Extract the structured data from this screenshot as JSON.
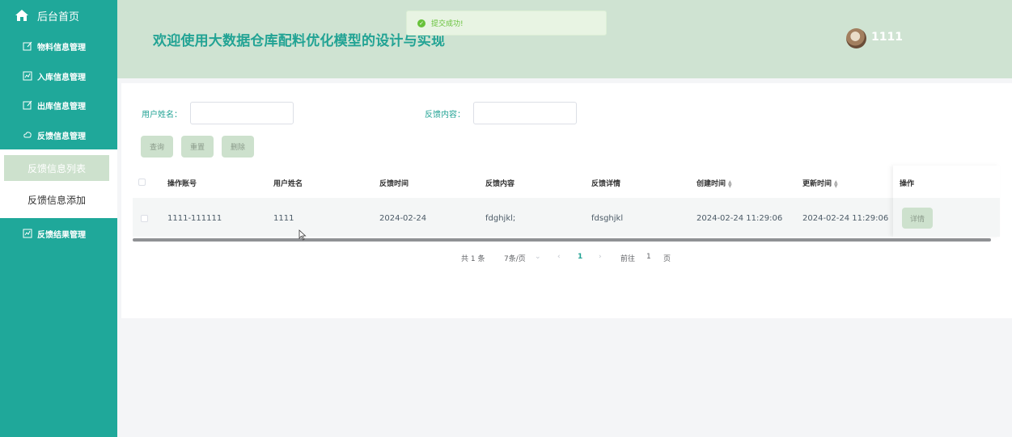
{
  "colors": {
    "sidebar": "#1fa89a",
    "header": "#cfe3d2",
    "accent": "#22a394",
    "button": "#cde1cd",
    "success": "#67c23a"
  },
  "sidebar": {
    "home_label": "后台首页",
    "items": [
      {
        "label": "物料信息管理",
        "icon": "edit-icon"
      },
      {
        "label": "入库信息管理",
        "icon": "chart-icon"
      },
      {
        "label": "出库信息管理",
        "icon": "edit-icon"
      },
      {
        "label": "反馈信息管理",
        "icon": "cloud-icon"
      },
      {
        "label": "反馈结果管理",
        "icon": "chart-icon"
      }
    ],
    "submenu": [
      {
        "label": "反馈信息列表",
        "active": true
      },
      {
        "label": "反馈信息添加",
        "active": false
      }
    ]
  },
  "header": {
    "title": "欢迎使用大数据仓库配料优化模型的设计与实现",
    "username": "1111"
  },
  "toast": {
    "message": "提交成功!"
  },
  "search": {
    "username_label": "用户姓名：",
    "username_value": "",
    "content_label": "反馈内容：",
    "content_value": ""
  },
  "buttons": {
    "query": "查询",
    "reset": "重置",
    "delete": "删除"
  },
  "table": {
    "headers": [
      "操作账号",
      "用户姓名",
      "反馈时间",
      "反馈内容",
      "反馈详情",
      "创建时间",
      "更新时间",
      "操作"
    ],
    "rows": [
      {
        "account": "1111-111111",
        "username": "1111",
        "feedback_time": "2024-02-24",
        "content": "fdghjkl;",
        "detail": "fdsghjkl",
        "created": "2024-02-24 11:29:06",
        "updated": "2024-02-24 11:29:06",
        "action": "详情"
      }
    ]
  },
  "pagination": {
    "total": "共 1 条",
    "page_size": "7条/页",
    "current_page": "1",
    "goto_label": "前往",
    "goto_value": "1",
    "page_suffix": "页"
  }
}
